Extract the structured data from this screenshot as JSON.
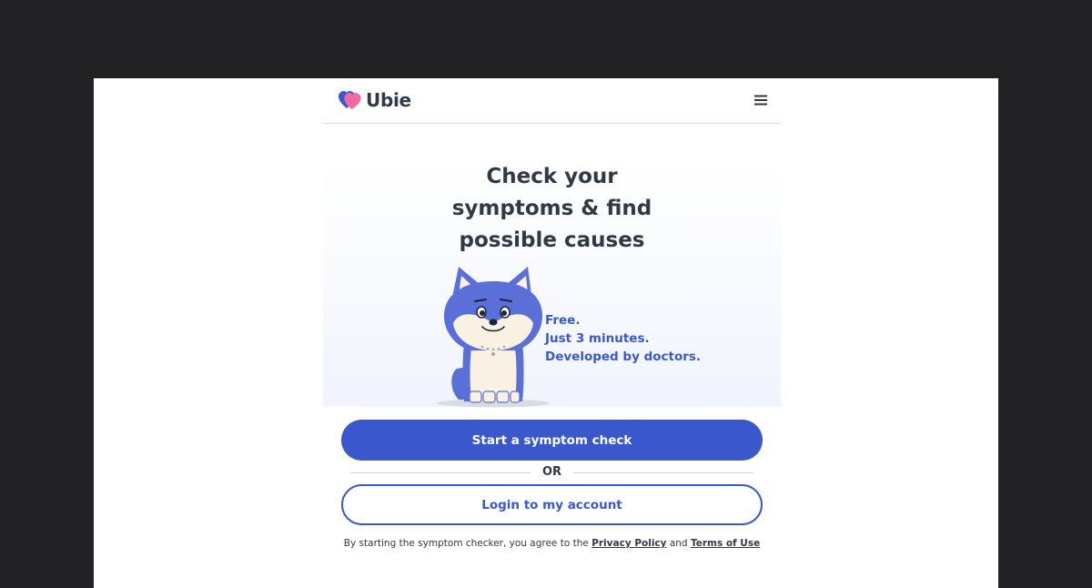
{
  "brand": {
    "name": "Ubie",
    "accent_color": "#3a58cc",
    "logo_heart_color": "#f06aa0"
  },
  "header": {
    "menu_icon": "hamburger-menu-icon"
  },
  "hero": {
    "headline_lines": [
      "Check your",
      "symptoms & find",
      "possible causes"
    ],
    "taglines": [
      "Free.",
      "Just 3 minutes.",
      "Developed by doctors."
    ],
    "mascot": "cartoon-dog-mascot"
  },
  "actions": {
    "start_label": "Start a symptom check",
    "or_label": "OR",
    "login_label": "Login to my account"
  },
  "disclaimer": {
    "prefix": "By starting the symptom checker, you agree to the",
    "privacy_label": "Privacy Policy",
    "and_label": "and",
    "terms_label": "Terms of Use"
  }
}
